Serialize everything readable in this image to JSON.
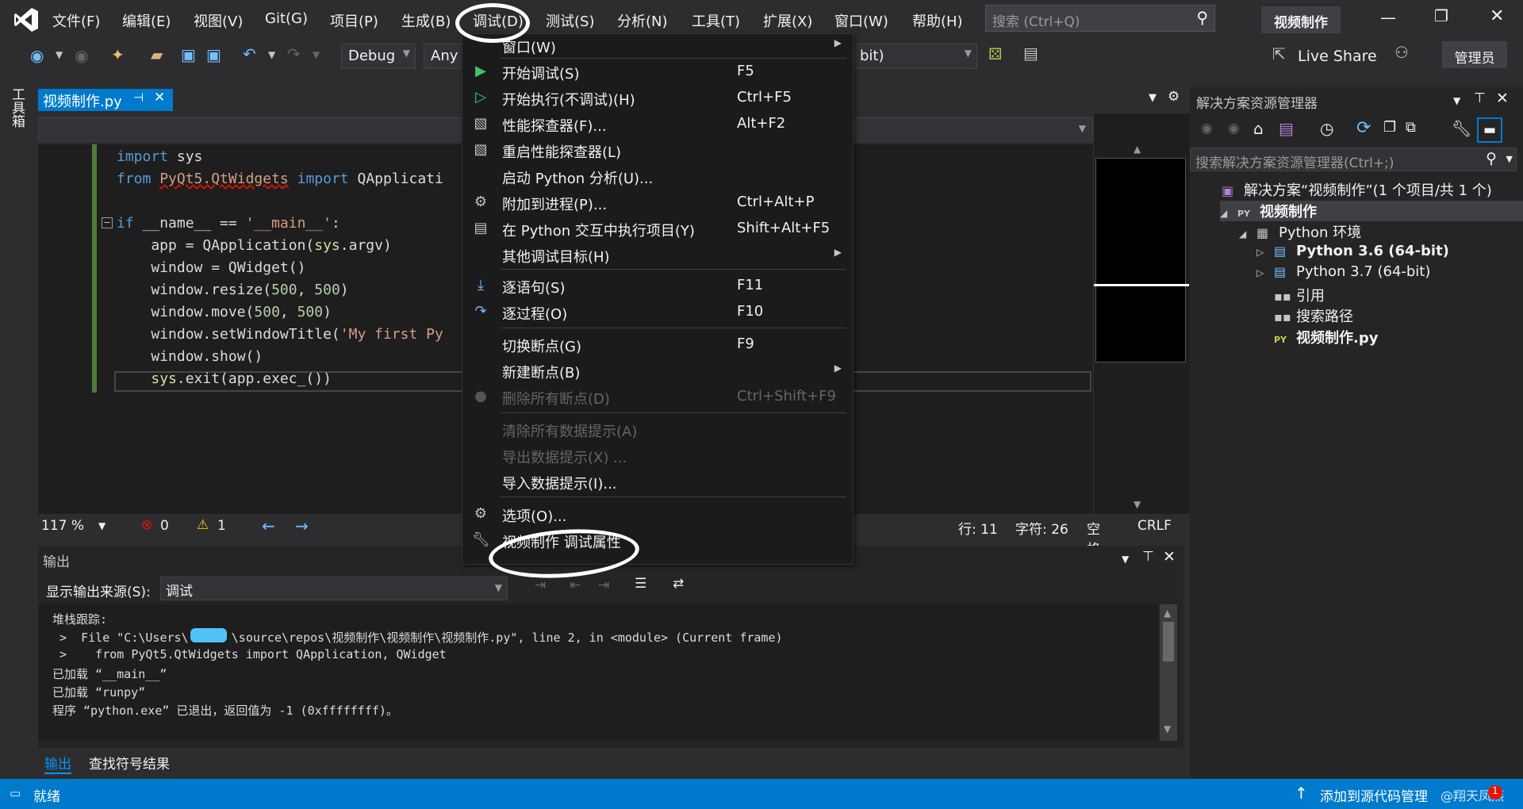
{
  "app": {
    "menu": [
      "文件(F)",
      "编辑(E)",
      "视图(V)",
      "Git(G)",
      "项目(P)",
      "生成(B)",
      "调试(D)",
      "测试(S)",
      "分析(N)",
      "工具(T)",
      "扩展(X)",
      "窗口(W)",
      "帮助(H)"
    ],
    "search_placeholder": "搜索 (Ctrl+Q)",
    "solution_badge": "视频制作",
    "live_share": "Live Share",
    "admin": "管理员"
  },
  "toolbar": {
    "config": "Debug",
    "platform": "Any",
    "start_target_suffix": "bit)"
  },
  "left_strip": {
    "toolbox": "工具箱"
  },
  "editor": {
    "tab_title": "视频制作.py",
    "pin": "⊣",
    "code_lines": [
      [
        {
          "t": "import",
          "c": "kw"
        },
        {
          "t": " sys",
          "c": "id"
        }
      ],
      [
        {
          "t": "from",
          "c": "kw"
        },
        {
          "t": " ",
          "c": "id"
        },
        {
          "t": "PyQt5.QtWidgets",
          "c": "err"
        },
        {
          "t": " ",
          "c": "id"
        },
        {
          "t": "import",
          "c": "kw"
        },
        {
          "t": " QApplicati",
          "c": "id"
        }
      ],
      [],
      [
        {
          "t": "if",
          "c": "kw"
        },
        {
          "t": " __name__ == ",
          "c": "id"
        },
        {
          "t": "'__main__'",
          "c": "str"
        },
        {
          "t": ":",
          "c": "id"
        }
      ],
      [
        {
          "t": "    app = QApplication(",
          "c": "id"
        },
        {
          "t": "sys",
          "c": "mod"
        },
        {
          "t": ".argv)",
          "c": "id"
        }
      ],
      [
        {
          "t": "    window = QWidget()",
          "c": "id"
        }
      ],
      [
        {
          "t": "    window.resize(",
          "c": "id"
        },
        {
          "t": "500",
          "c": "num"
        },
        {
          "t": ", ",
          "c": "id"
        },
        {
          "t": "500",
          "c": "num"
        },
        {
          "t": ")",
          "c": "id"
        }
      ],
      [
        {
          "t": "    window.move(",
          "c": "id"
        },
        {
          "t": "500",
          "c": "num"
        },
        {
          "t": ", ",
          "c": "id"
        },
        {
          "t": "500",
          "c": "num"
        },
        {
          "t": ")",
          "c": "id"
        }
      ],
      [
        {
          "t": "    window.setWindowTitle(",
          "c": "id"
        },
        {
          "t": "'My first Py",
          "c": "str"
        }
      ],
      [
        {
          "t": "    window.show()",
          "c": "id"
        }
      ],
      [
        {
          "t": "    ",
          "c": "id"
        },
        {
          "t": "sys",
          "c": "mod"
        },
        {
          "t": ".exit(app.exec_())",
          "c": "id"
        }
      ]
    ],
    "zoom": "117 %",
    "errors": "0",
    "warnings": "1",
    "line": "行: 11",
    "char": "字符: 26",
    "spaces": "空格",
    "eol": "CRLF"
  },
  "debug_menu": {
    "items": [
      {
        "label": "窗口(W)",
        "key": "",
        "icon": "",
        "submenu": true,
        "disabled": false
      },
      {
        "label": "开始调试(S)",
        "key": "F5",
        "icon": "play-icon",
        "submenu": false,
        "disabled": false
      },
      {
        "label": "开始执行(不调试)(H)",
        "key": "Ctrl+F5",
        "icon": "play-outline-icon",
        "submenu": false,
        "disabled": false
      },
      {
        "label": "性能探查器(F)...",
        "key": "Alt+F2",
        "icon": "profiler-icon",
        "submenu": false,
        "disabled": false
      },
      {
        "label": "重启性能探查器(L)",
        "key": "",
        "icon": "profiler-restart-icon",
        "submenu": false,
        "disabled": false
      },
      {
        "label": "启动 Python 分析(U)...",
        "key": "",
        "icon": "",
        "submenu": false,
        "disabled": false
      },
      {
        "label": "附加到进程(P)...",
        "key": "Ctrl+Alt+P",
        "icon": "attach-icon",
        "submenu": false,
        "disabled": false
      },
      {
        "label": "在 Python 交互中执行项目(Y)",
        "key": "Shift+Alt+F5",
        "icon": "interactive-icon",
        "submenu": false,
        "disabled": false
      },
      {
        "label": "其他调试目标(H)",
        "key": "",
        "icon": "",
        "submenu": true,
        "disabled": false
      },
      {
        "label": "逐语句(S)",
        "key": "F11",
        "icon": "step-into-icon",
        "submenu": false,
        "disabled": false
      },
      {
        "label": "逐过程(O)",
        "key": "F10",
        "icon": "step-over-icon",
        "submenu": false,
        "disabled": false
      },
      {
        "label": "切换断点(G)",
        "key": "F9",
        "icon": "",
        "submenu": false,
        "disabled": false
      },
      {
        "label": "新建断点(B)",
        "key": "",
        "icon": "",
        "submenu": true,
        "disabled": false
      },
      {
        "label": "删除所有断点(D)",
        "key": "Ctrl+Shift+F9",
        "icon": "delete-breakpoints-icon",
        "submenu": false,
        "disabled": true
      },
      {
        "label": "清除所有数据提示(A)",
        "key": "",
        "icon": "",
        "submenu": false,
        "disabled": true
      },
      {
        "label": "导出数据提示(X) ...",
        "key": "",
        "icon": "",
        "submenu": false,
        "disabled": true
      },
      {
        "label": "导入数据提示(I)...",
        "key": "",
        "icon": "",
        "submenu": false,
        "disabled": false
      },
      {
        "label": "选项(O)...",
        "key": "",
        "icon": "gear-icon",
        "submenu": false,
        "disabled": false
      },
      {
        "label": "视频制作 调试属性",
        "key": "",
        "icon": "wrench-icon",
        "submenu": false,
        "disabled": false
      }
    ]
  },
  "output": {
    "title": "输出",
    "source_label": "显示输出来源(S):",
    "source_value": "调试",
    "lines": [
      "堆栈跟踪:",
      " >  File \"C:\\Users\\      \\source\\repos\\视频制作\\视频制作\\视频制作.py\", line 2, in <module> (Current frame)",
      " >    from PyQt5.QtWidgets import QApplication, QWidget",
      "已加载 “__main__”",
      "已加载 “runpy”",
      "程序 “python.exe” 已退出，返回值为 -1 (0xffffffff)。"
    ],
    "tab_output": "输出",
    "tab_symbols": "查找符号结果"
  },
  "solution_explorer": {
    "title": "解决方案资源管理器",
    "search_placeholder": "搜索解决方案资源管理器(Ctrl+;)",
    "tree": [
      {
        "label": "解决方案“视频制作”(1 个项目/共 1 个)",
        "bold": false
      },
      {
        "label": "视频制作",
        "bold": true
      },
      {
        "label": "Python 环境",
        "bold": false
      },
      {
        "label": "Python 3.6 (64-bit)",
        "bold": true
      },
      {
        "label": "Python 3.7 (64-bit)",
        "bold": false
      },
      {
        "label": "引用",
        "bold": false
      },
      {
        "label": "搜索路径",
        "bold": false
      },
      {
        "label": "视频制作.py",
        "bold": true
      }
    ],
    "py_badge": "PY"
  },
  "status": {
    "ready": "就绪",
    "source_control": "添加到源代码管理",
    "watermark": "@翔天凤燕",
    "notif_count": "1"
  },
  "colors": {
    "accent": "#007acc",
    "kw": "#569cd6",
    "str": "#d69d85",
    "num": "#b5cea8",
    "id": "#dcdcdc",
    "mod": "#dcdcaa",
    "err": "#d69d85"
  }
}
